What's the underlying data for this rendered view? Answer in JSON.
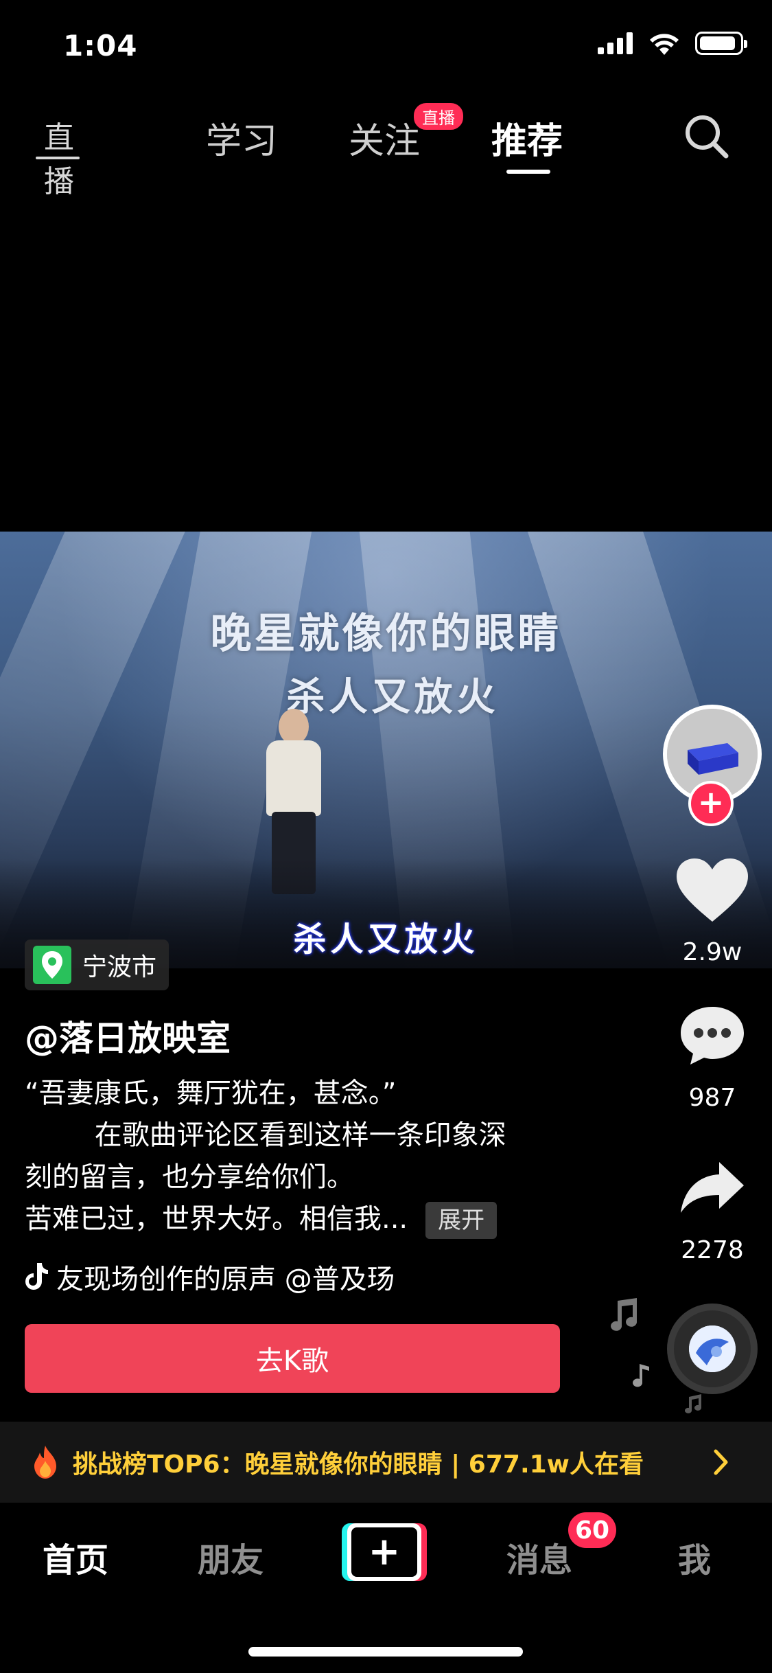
{
  "status_bar": {
    "time": "1:04"
  },
  "top_nav": {
    "live_icon_label": "直播",
    "tabs": [
      {
        "label": "学习"
      },
      {
        "label": "关注",
        "badge": "直播"
      },
      {
        "label": "推荐",
        "active": true
      }
    ]
  },
  "video": {
    "screen_line1": "晚星就像你的眼睛",
    "screen_line2": "杀人又放火",
    "subtitle": "杀人又放火",
    "location": "宁波市"
  },
  "rail": {
    "likes": "2.9w",
    "comments": "987",
    "shares": "2278"
  },
  "post": {
    "author": "@落日放映室",
    "desc_lines": [
      "“吾妻康氏，舞厅犹在，甚念。”",
      "        在歌曲评论区看到这样一条印象深",
      "刻的留言，也分享给你们。",
      "苦难已过，世界大好。相信我..."
    ],
    "expand_label": "展开",
    "music_text": "友现场创作的原声    @普及玚"
  },
  "ksong_button": "去K歌",
  "challenge": {
    "text": "挑战榜TOP6：晚星就像你的眼睛 | 677.1w人在看"
  },
  "bottom_nav": {
    "items": [
      "首页",
      "朋友",
      "消息",
      "我"
    ],
    "message_badge": "60"
  },
  "colors": {
    "accent_red": "#ff2c55",
    "ksong_red": "#f04458",
    "challenge_yellow": "#ffcf3a",
    "location_green": "#29c15b"
  }
}
